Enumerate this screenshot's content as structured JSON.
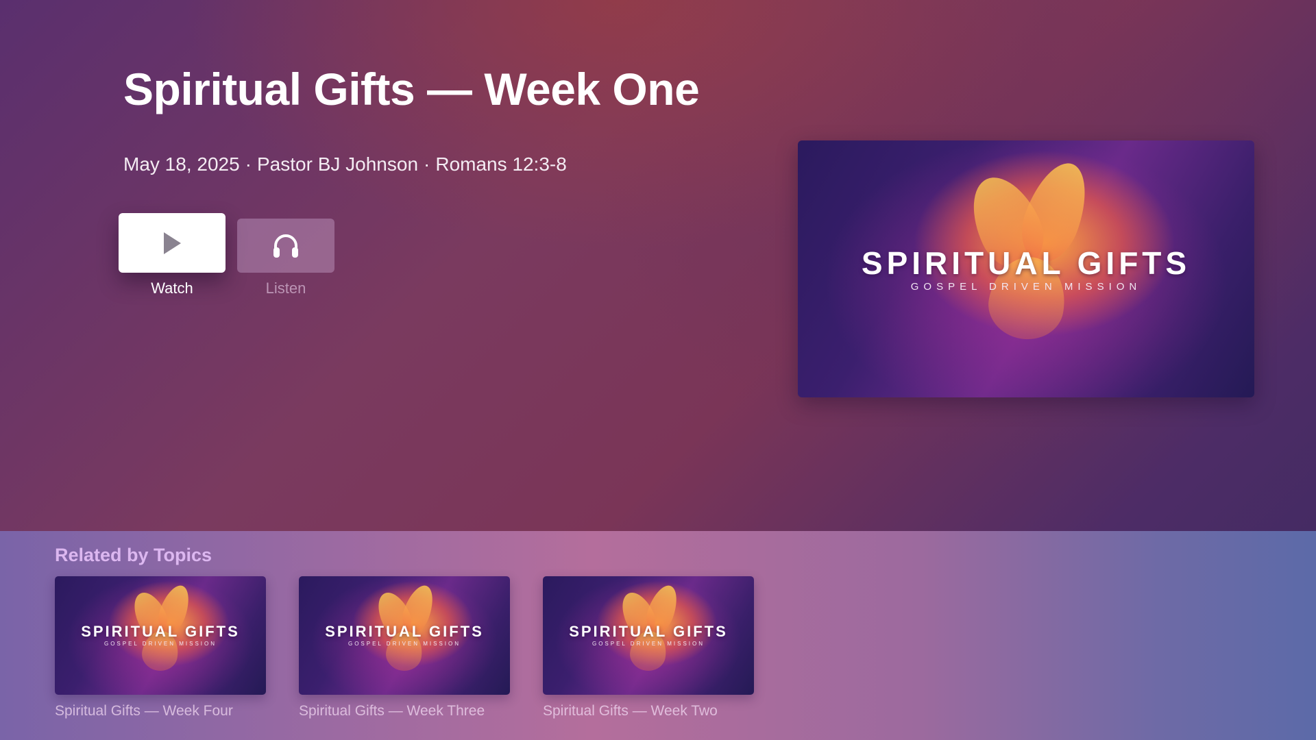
{
  "hero": {
    "title": "Spiritual Gifts — Week One",
    "date": "May 18, 2025",
    "separator": "·",
    "speaker": "Pastor BJ Johnson",
    "scripture": "Romans 12:3-8",
    "watch_label": "Watch",
    "listen_label": "Listen",
    "watch_icon": "play-icon",
    "listen_icon": "headphones-icon"
  },
  "poster": {
    "art_title": "SPIRITUAL GIFTS",
    "art_subtitle": "GOSPEL DRIVEN MISSION"
  },
  "related": {
    "heading": "Related by Topics",
    "items": [
      {
        "label": "Spiritual Gifts — Week Four",
        "art_title": "SPIRITUAL GIFTS",
        "art_subtitle": "GOSPEL DRIVEN MISSION"
      },
      {
        "label": "Spiritual Gifts — Week Three",
        "art_title": "SPIRITUAL GIFTS",
        "art_subtitle": "GOSPEL DRIVEN MISSION"
      },
      {
        "label": "Spiritual Gifts — Week Two",
        "art_title": "SPIRITUAL GIFTS",
        "art_subtitle": "GOSPEL DRIVEN MISSION"
      }
    ]
  },
  "colors": {
    "accent_heading": "#dcb7f0",
    "button_focus": "#ffffff"
  }
}
